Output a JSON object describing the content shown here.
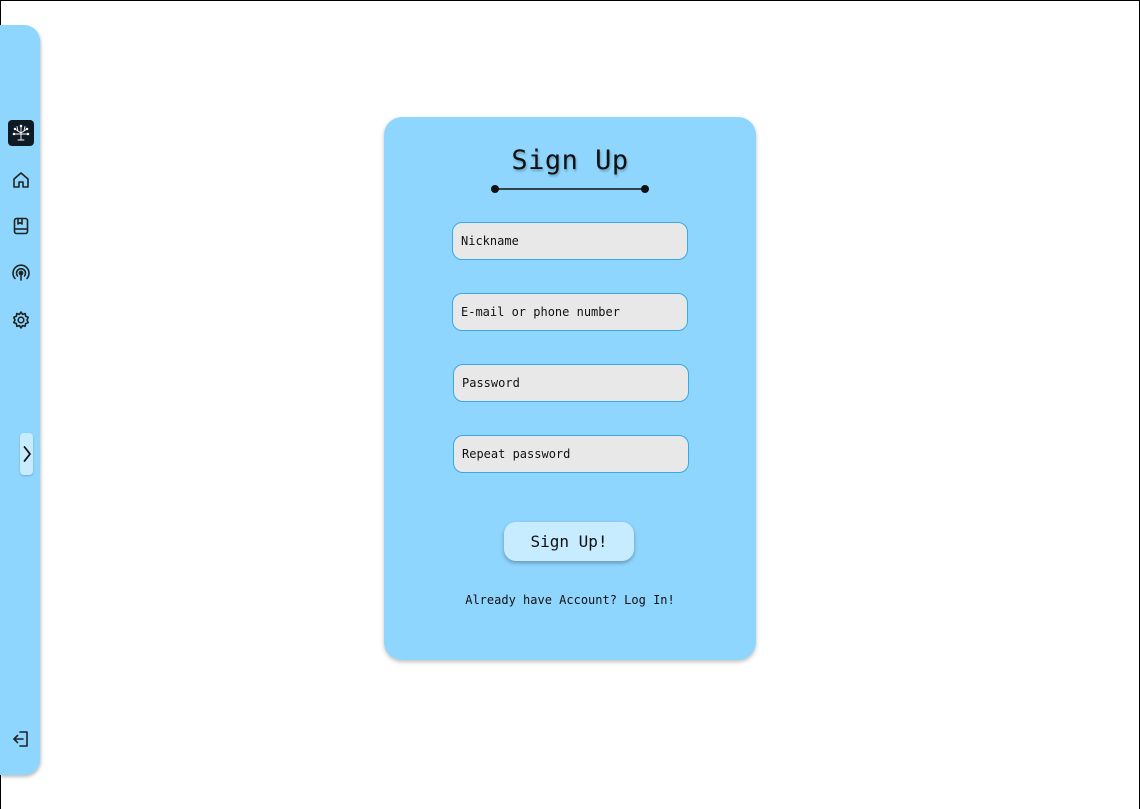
{
  "sidebar": {
    "logo_icon": "tree-logo-icon",
    "items": [
      {
        "name": "home",
        "icon": "home-icon"
      },
      {
        "name": "library",
        "icon": "bookmark-book-icon"
      },
      {
        "name": "broadcast",
        "icon": "broadcast-icon"
      },
      {
        "name": "settings",
        "icon": "gear-icon"
      }
    ],
    "toggle_icon": "chevron-right-icon",
    "logout_icon": "logout-icon",
    "background_color": "#8fd6fe"
  },
  "signup": {
    "title": "Sign Up",
    "fields": {
      "nickname_placeholder": "Nickname",
      "email_placeholder": "E-mail or phone number",
      "password_placeholder": "Password",
      "repeat_password_placeholder": "Repeat password"
    },
    "submit_label": "Sign Up!",
    "login_prompt": "Already have Account? Log In!",
    "card_color": "#8fd6fe",
    "field_color": "#e8e8e8",
    "button_color": "#c8ecff"
  }
}
